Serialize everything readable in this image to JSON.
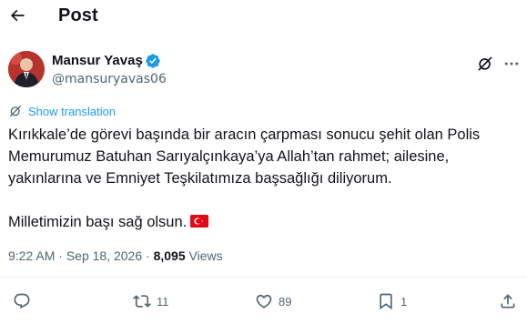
{
  "header": {
    "title": "Post"
  },
  "author": {
    "display_name": "Mansur Yavaş",
    "handle": "@mansuryavas06"
  },
  "translate": {
    "label": "Show translation"
  },
  "tweet": {
    "paragraph1": "Kırıkkale’de görevi başında bir aracın çarpması sonucu şehit olan Polis Memurumuz Batuhan Sarıyalçınkaya’ya Allah’tan rahmet; ailesine, yakınlarına ve Emniyet Teşkilatımıza başsağlığı diliyorum.",
    "paragraph2": "Milletimizin başı sağ olsun."
  },
  "meta": {
    "time": "9:22 AM",
    "separator": "·",
    "date": "Sep 18, 2026",
    "views_count": "8,095",
    "views_label": "Views"
  },
  "actions": {
    "reply_count": "",
    "retweet_count": "11",
    "like_count": "89",
    "bookmark_count": "1"
  },
  "colors": {
    "accent": "#1d9bf0",
    "muted": "#536471",
    "text": "#0f1419",
    "flag_red": "#e30a17"
  },
  "icons": [
    "back-arrow-icon",
    "verified-badge-icon",
    "grok-icon",
    "more-icon",
    "translate-icon",
    "reply-icon",
    "retweet-icon",
    "like-icon",
    "bookmark-icon",
    "share-icon",
    "turkey-flag-icon"
  ]
}
